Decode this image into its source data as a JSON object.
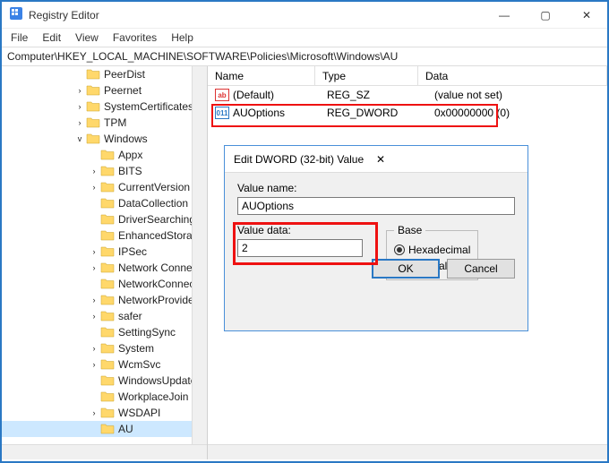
{
  "window": {
    "title": "Registry Editor",
    "min": "—",
    "max": "▢",
    "close": "✕"
  },
  "menu": {
    "file": "File",
    "edit": "Edit",
    "view": "View",
    "favorites": "Favorites",
    "help": "Help"
  },
  "address": "Computer\\HKEY_LOCAL_MACHINE\\SOFTWARE\\Policies\\Microsoft\\Windows\\AU",
  "tree": [
    {
      "label": "PeerDist",
      "indent": 5,
      "twisty": ""
    },
    {
      "label": "Peernet",
      "indent": 5,
      "twisty": "›"
    },
    {
      "label": "SystemCertificates",
      "indent": 5,
      "twisty": "›"
    },
    {
      "label": "TPM",
      "indent": 5,
      "twisty": "›"
    },
    {
      "label": "Windows",
      "indent": 5,
      "twisty": "v",
      "expanded": true
    },
    {
      "label": "Appx",
      "indent": 6,
      "twisty": ""
    },
    {
      "label": "BITS",
      "indent": 6,
      "twisty": "›"
    },
    {
      "label": "CurrentVersion",
      "indent": 6,
      "twisty": "›"
    },
    {
      "label": "DataCollection",
      "indent": 6,
      "twisty": ""
    },
    {
      "label": "DriverSearching",
      "indent": 6,
      "twisty": ""
    },
    {
      "label": "EnhancedStorage",
      "indent": 6,
      "twisty": ""
    },
    {
      "label": "IPSec",
      "indent": 6,
      "twisty": "›"
    },
    {
      "label": "Network Connect",
      "indent": 6,
      "twisty": "›"
    },
    {
      "label": "NetworkConnecti",
      "indent": 6,
      "twisty": ""
    },
    {
      "label": "NetworkProvider",
      "indent": 6,
      "twisty": "›"
    },
    {
      "label": "safer",
      "indent": 6,
      "twisty": "›"
    },
    {
      "label": "SettingSync",
      "indent": 6,
      "twisty": ""
    },
    {
      "label": "System",
      "indent": 6,
      "twisty": "›"
    },
    {
      "label": "WcmSvc",
      "indent": 6,
      "twisty": "›"
    },
    {
      "label": "WindowsUpdate",
      "indent": 6,
      "twisty": ""
    },
    {
      "label": "WorkplaceJoin",
      "indent": 6,
      "twisty": ""
    },
    {
      "label": "WSDAPI",
      "indent": 6,
      "twisty": "›"
    },
    {
      "label": "AU",
      "indent": 6,
      "twisty": "",
      "selected": true
    }
  ],
  "columns": {
    "name": "Name",
    "type": "Type",
    "data": "Data"
  },
  "rows": [
    {
      "icon": "ab",
      "name": "(Default)",
      "type": "REG_SZ",
      "data": "(value not set)"
    },
    {
      "icon": "011",
      "name": "AUOptions",
      "type": "REG_DWORD",
      "data": "0x00000000 (0)"
    }
  ],
  "dialog": {
    "title": "Edit DWORD (32-bit) Value",
    "valueNameLabel": "Value name:",
    "valueName": "AUOptions",
    "valueDataLabel": "Value data:",
    "valueData": "2",
    "baseLabel": "Base",
    "hex": "Hexadecimal",
    "dec": "Decimal",
    "ok": "OK",
    "cancel": "Cancel",
    "close": "✕"
  }
}
